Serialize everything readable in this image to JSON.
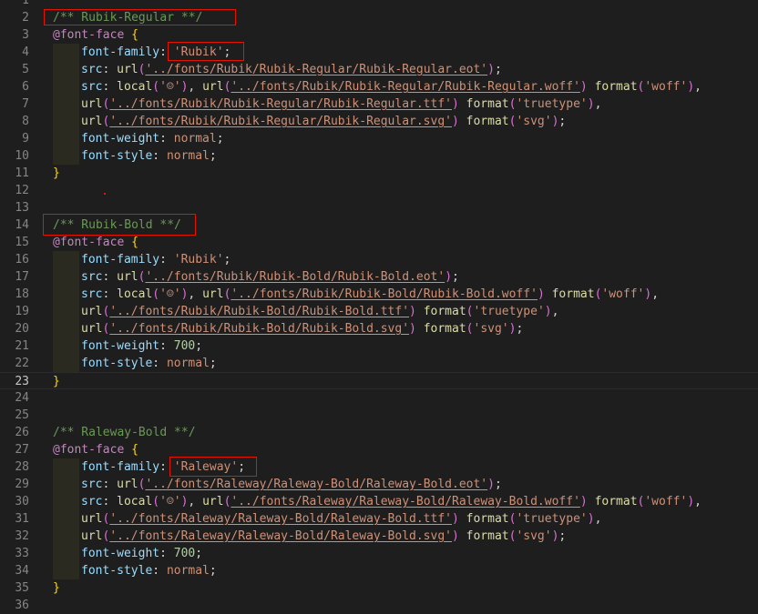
{
  "lines": [
    {
      "n": "1",
      "segs": []
    },
    {
      "n": "2",
      "segs": [
        {
          "t": "/** Rubik-Regular **/",
          "c": "comment"
        }
      ]
    },
    {
      "n": "3",
      "segs": [
        {
          "t": "@font-face",
          "c": "at"
        },
        {
          "t": " ",
          "c": "ident"
        },
        {
          "t": "{",
          "c": "brace"
        }
      ]
    },
    {
      "n": "4",
      "indent": true,
      "segs": [
        {
          "t": "font-family",
          "c": "prop"
        },
        {
          "t": ": ",
          "c": "ident"
        },
        {
          "t": "'Rubik'",
          "c": "str"
        },
        {
          "t": ";",
          "c": "ident"
        }
      ]
    },
    {
      "n": "5",
      "indent": true,
      "segs": [
        {
          "t": "src",
          "c": "prop"
        },
        {
          "t": ": ",
          "c": "ident"
        },
        {
          "t": "url",
          "c": "kw"
        },
        {
          "t": "(",
          "c": "paren"
        },
        {
          "t": "'../fonts/Rubik/Rubik-Regular/Rubik-Regular.eot'",
          "c": "str",
          "u": true
        },
        {
          "t": ")",
          "c": "paren"
        },
        {
          "t": ";",
          "c": "ident"
        }
      ]
    },
    {
      "n": "6",
      "indent": true,
      "segs": [
        {
          "t": "src",
          "c": "prop"
        },
        {
          "t": ": ",
          "c": "ident"
        },
        {
          "t": "local",
          "c": "kw"
        },
        {
          "t": "(",
          "c": "paren"
        },
        {
          "t": "'☺'",
          "c": "str"
        },
        {
          "t": ")",
          "c": "paren"
        },
        {
          "t": ", ",
          "c": "ident"
        },
        {
          "t": "url",
          "c": "kw"
        },
        {
          "t": "(",
          "c": "paren"
        },
        {
          "t": "'../fonts/Rubik/Rubik-Regular/Rubik-Regular.woff'",
          "c": "str",
          "u": true
        },
        {
          "t": ")",
          "c": "paren"
        },
        {
          "t": " ",
          "c": "ident"
        },
        {
          "t": "format",
          "c": "kw"
        },
        {
          "t": "(",
          "c": "paren"
        },
        {
          "t": "'woff'",
          "c": "str"
        },
        {
          "t": ")",
          "c": "paren"
        },
        {
          "t": ",",
          "c": "ident"
        }
      ]
    },
    {
      "n": "7",
      "indent": true,
      "segs": [
        {
          "t": "url",
          "c": "kw"
        },
        {
          "t": "(",
          "c": "paren"
        },
        {
          "t": "'../fonts/Rubik/Rubik-Regular/Rubik-Regular.ttf'",
          "c": "str",
          "u": true
        },
        {
          "t": ")",
          "c": "paren"
        },
        {
          "t": " ",
          "c": "ident"
        },
        {
          "t": "format",
          "c": "kw"
        },
        {
          "t": "(",
          "c": "paren"
        },
        {
          "t": "'truetype'",
          "c": "str"
        },
        {
          "t": ")",
          "c": "paren"
        },
        {
          "t": ",",
          "c": "ident"
        }
      ]
    },
    {
      "n": "8",
      "indent": true,
      "segs": [
        {
          "t": "url",
          "c": "kw"
        },
        {
          "t": "(",
          "c": "paren"
        },
        {
          "t": "'../fonts/Rubik/Rubik-Regular/Rubik-Regular.svg'",
          "c": "str",
          "u": true
        },
        {
          "t": ")",
          "c": "paren"
        },
        {
          "t": " ",
          "c": "ident"
        },
        {
          "t": "format",
          "c": "kw"
        },
        {
          "t": "(",
          "c": "paren"
        },
        {
          "t": "'svg'",
          "c": "str"
        },
        {
          "t": ")",
          "c": "paren"
        },
        {
          "t": ";",
          "c": "ident"
        }
      ]
    },
    {
      "n": "9",
      "indent": true,
      "segs": [
        {
          "t": "font-weight",
          "c": "prop"
        },
        {
          "t": ": ",
          "c": "ident"
        },
        {
          "t": "normal",
          "c": "str"
        },
        {
          "t": ";",
          "c": "ident"
        }
      ]
    },
    {
      "n": "10",
      "indent": true,
      "segs": [
        {
          "t": "font-style",
          "c": "prop"
        },
        {
          "t": ": ",
          "c": "ident"
        },
        {
          "t": "normal",
          "c": "str"
        },
        {
          "t": ";",
          "c": "ident"
        }
      ]
    },
    {
      "n": "11",
      "segs": [
        {
          "t": "}",
          "c": "brace"
        }
      ]
    },
    {
      "n": "12",
      "segs": []
    },
    {
      "n": "13",
      "segs": []
    },
    {
      "n": "14",
      "segs": [
        {
          "t": "/** Rubik-Bold **/",
          "c": "comment"
        }
      ]
    },
    {
      "n": "15",
      "segs": [
        {
          "t": "@font-face",
          "c": "at"
        },
        {
          "t": " ",
          "c": "ident"
        },
        {
          "t": "{",
          "c": "brace"
        }
      ]
    },
    {
      "n": "16",
      "indent": true,
      "segs": [
        {
          "t": "font-family",
          "c": "prop"
        },
        {
          "t": ": ",
          "c": "ident"
        },
        {
          "t": "'Rubik'",
          "c": "str"
        },
        {
          "t": ";",
          "c": "ident"
        }
      ]
    },
    {
      "n": "17",
      "indent": true,
      "segs": [
        {
          "t": "src",
          "c": "prop"
        },
        {
          "t": ": ",
          "c": "ident"
        },
        {
          "t": "url",
          "c": "kw"
        },
        {
          "t": "(",
          "c": "paren"
        },
        {
          "t": "'../fonts/Rubik/Rubik-Bold/Rubik-Bold.eot'",
          "c": "str",
          "u": true
        },
        {
          "t": ")",
          "c": "paren"
        },
        {
          "t": ";",
          "c": "ident"
        }
      ]
    },
    {
      "n": "18",
      "indent": true,
      "segs": [
        {
          "t": "src",
          "c": "prop"
        },
        {
          "t": ": ",
          "c": "ident"
        },
        {
          "t": "local",
          "c": "kw"
        },
        {
          "t": "(",
          "c": "paren"
        },
        {
          "t": "'☺'",
          "c": "str"
        },
        {
          "t": ")",
          "c": "paren"
        },
        {
          "t": ", ",
          "c": "ident"
        },
        {
          "t": "url",
          "c": "kw"
        },
        {
          "t": "(",
          "c": "paren"
        },
        {
          "t": "'../fonts/Rubik/Rubik-Bold/Rubik-Bold.woff'",
          "c": "str",
          "u": true
        },
        {
          "t": ")",
          "c": "paren"
        },
        {
          "t": " ",
          "c": "ident"
        },
        {
          "t": "format",
          "c": "kw"
        },
        {
          "t": "(",
          "c": "paren"
        },
        {
          "t": "'woff'",
          "c": "str"
        },
        {
          "t": ")",
          "c": "paren"
        },
        {
          "t": ",",
          "c": "ident"
        }
      ]
    },
    {
      "n": "19",
      "indent": true,
      "segs": [
        {
          "t": "url",
          "c": "kw"
        },
        {
          "t": "(",
          "c": "paren"
        },
        {
          "t": "'../fonts/Rubik/Rubik-Bold/Rubik-Bold.ttf'",
          "c": "str",
          "u": true
        },
        {
          "t": ")",
          "c": "paren"
        },
        {
          "t": " ",
          "c": "ident"
        },
        {
          "t": "format",
          "c": "kw"
        },
        {
          "t": "(",
          "c": "paren"
        },
        {
          "t": "'truetype'",
          "c": "str"
        },
        {
          "t": ")",
          "c": "paren"
        },
        {
          "t": ",",
          "c": "ident"
        }
      ]
    },
    {
      "n": "20",
      "indent": true,
      "segs": [
        {
          "t": "url",
          "c": "kw"
        },
        {
          "t": "(",
          "c": "paren"
        },
        {
          "t": "'../fonts/Rubik/Rubik-Bold/Rubik-Bold.svg'",
          "c": "str",
          "u": true
        },
        {
          "t": ")",
          "c": "paren"
        },
        {
          "t": " ",
          "c": "ident"
        },
        {
          "t": "format",
          "c": "kw"
        },
        {
          "t": "(",
          "c": "paren"
        },
        {
          "t": "'svg'",
          "c": "str"
        },
        {
          "t": ")",
          "c": "paren"
        },
        {
          "t": ";",
          "c": "ident"
        }
      ]
    },
    {
      "n": "21",
      "indent": true,
      "segs": [
        {
          "t": "font-weight",
          "c": "prop"
        },
        {
          "t": ": ",
          "c": "ident"
        },
        {
          "t": "700",
          "c": "num"
        },
        {
          "t": ";",
          "c": "ident"
        }
      ]
    },
    {
      "n": "22",
      "indent": true,
      "segs": [
        {
          "t": "font-style",
          "c": "prop"
        },
        {
          "t": ": ",
          "c": "ident"
        },
        {
          "t": "normal",
          "c": "str"
        },
        {
          "t": ";",
          "c": "ident"
        }
      ]
    },
    {
      "n": "23",
      "current": true,
      "segs": [
        {
          "t": "}",
          "c": "brace"
        }
      ]
    },
    {
      "n": "24",
      "segs": []
    },
    {
      "n": "25",
      "segs": []
    },
    {
      "n": "26",
      "segs": [
        {
          "t": "/** Raleway-Bold **/",
          "c": "comment"
        }
      ]
    },
    {
      "n": "27",
      "segs": [
        {
          "t": "@font-face",
          "c": "at"
        },
        {
          "t": " ",
          "c": "ident"
        },
        {
          "t": "{",
          "c": "brace"
        }
      ]
    },
    {
      "n": "28",
      "indent": true,
      "segs": [
        {
          "t": "font-family",
          "c": "prop"
        },
        {
          "t": ": ",
          "c": "ident"
        },
        {
          "t": "'Raleway'",
          "c": "str"
        },
        {
          "t": ";",
          "c": "ident"
        }
      ]
    },
    {
      "n": "29",
      "indent": true,
      "segs": [
        {
          "t": "src",
          "c": "prop"
        },
        {
          "t": ": ",
          "c": "ident"
        },
        {
          "t": "url",
          "c": "kw"
        },
        {
          "t": "(",
          "c": "paren"
        },
        {
          "t": "'../fonts/Raleway/Raleway-Bold/Raleway-Bold.eot'",
          "c": "str",
          "u": true
        },
        {
          "t": ")",
          "c": "paren"
        },
        {
          "t": ";",
          "c": "ident"
        }
      ]
    },
    {
      "n": "30",
      "indent": true,
      "segs": [
        {
          "t": "src",
          "c": "prop"
        },
        {
          "t": ": ",
          "c": "ident"
        },
        {
          "t": "local",
          "c": "kw"
        },
        {
          "t": "(",
          "c": "paren"
        },
        {
          "t": "'☺'",
          "c": "str"
        },
        {
          "t": ")",
          "c": "paren"
        },
        {
          "t": ", ",
          "c": "ident"
        },
        {
          "t": "url",
          "c": "kw"
        },
        {
          "t": "(",
          "c": "paren"
        },
        {
          "t": "'../fonts/Raleway/Raleway-Bold/Raleway-Bold.woff'",
          "c": "str",
          "u": true
        },
        {
          "t": ")",
          "c": "paren"
        },
        {
          "t": " ",
          "c": "ident"
        },
        {
          "t": "format",
          "c": "kw"
        },
        {
          "t": "(",
          "c": "paren"
        },
        {
          "t": "'woff'",
          "c": "str"
        },
        {
          "t": ")",
          "c": "paren"
        },
        {
          "t": ",",
          "c": "ident"
        }
      ]
    },
    {
      "n": "31",
      "indent": true,
      "segs": [
        {
          "t": "url",
          "c": "kw"
        },
        {
          "t": "(",
          "c": "paren"
        },
        {
          "t": "'../fonts/Raleway/Raleway-Bold/Raleway-Bold.ttf'",
          "c": "str",
          "u": true
        },
        {
          "t": ")",
          "c": "paren"
        },
        {
          "t": " ",
          "c": "ident"
        },
        {
          "t": "format",
          "c": "kw"
        },
        {
          "t": "(",
          "c": "paren"
        },
        {
          "t": "'truetype'",
          "c": "str"
        },
        {
          "t": ")",
          "c": "paren"
        },
        {
          "t": ",",
          "c": "ident"
        }
      ]
    },
    {
      "n": "32",
      "indent": true,
      "segs": [
        {
          "t": "url",
          "c": "kw"
        },
        {
          "t": "(",
          "c": "paren"
        },
        {
          "t": "'../fonts/Raleway/Raleway-Bold/Raleway-Bold.svg'",
          "c": "str",
          "u": true
        },
        {
          "t": ")",
          "c": "paren"
        },
        {
          "t": " ",
          "c": "ident"
        },
        {
          "t": "format",
          "c": "kw"
        },
        {
          "t": "(",
          "c": "paren"
        },
        {
          "t": "'svg'",
          "c": "str"
        },
        {
          "t": ")",
          "c": "paren"
        },
        {
          "t": ";",
          "c": "ident"
        }
      ]
    },
    {
      "n": "33",
      "indent": true,
      "segs": [
        {
          "t": "font-weight",
          "c": "prop"
        },
        {
          "t": ": ",
          "c": "ident"
        },
        {
          "t": "700",
          "c": "num"
        },
        {
          "t": ";",
          "c": "ident"
        }
      ]
    },
    {
      "n": "34",
      "indent": true,
      "segs": [
        {
          "t": "font-style",
          "c": "prop"
        },
        {
          "t": ": ",
          "c": "ident"
        },
        {
          "t": "normal",
          "c": "str"
        },
        {
          "t": ";",
          "c": "ident"
        }
      ]
    },
    {
      "n": "35",
      "segs": [
        {
          "t": "}",
          "c": "brace"
        }
      ]
    },
    {
      "n": "36",
      "segs": []
    }
  ],
  "colors": {
    "background": "#1e1e1e",
    "comment": "#6a9955",
    "at_rule": "#c586c0",
    "function": "#dcdcaa",
    "property": "#9cdcfe",
    "string": "#ce9178",
    "number": "#b5cea8",
    "brace": "#ffd700",
    "paren": "#da70d6",
    "annotation_box": "#e51400"
  }
}
